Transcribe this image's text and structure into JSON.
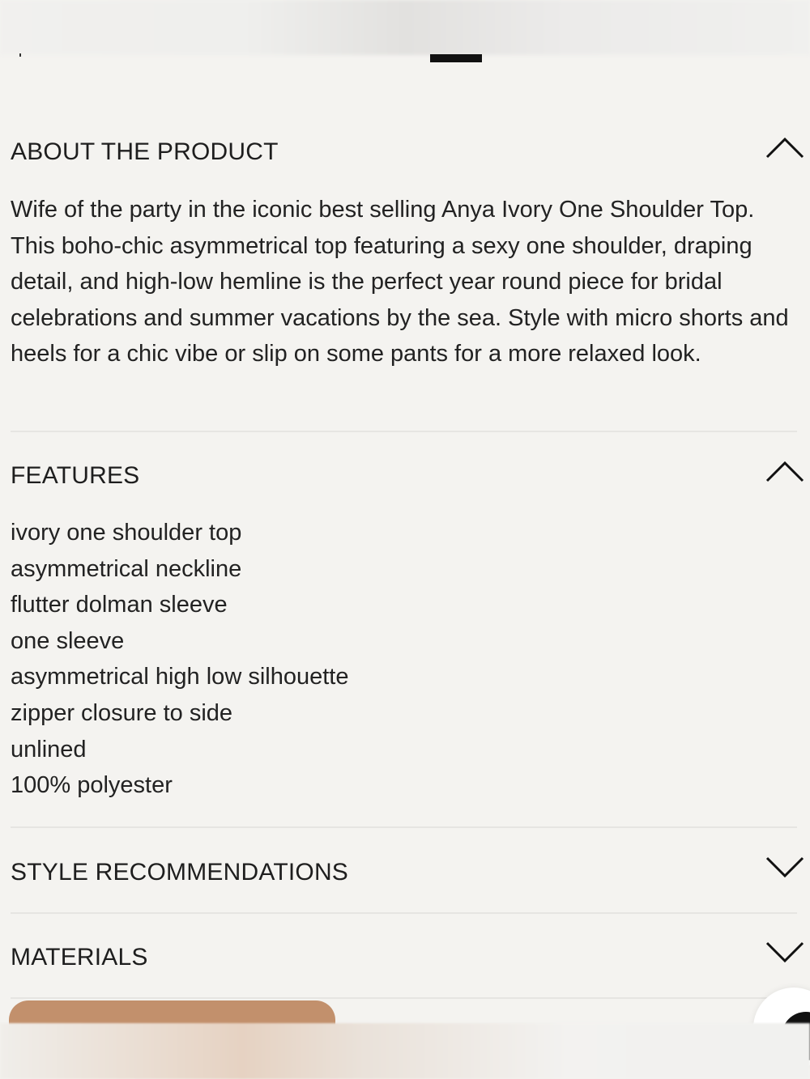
{
  "sections": {
    "about": {
      "title": "ABOUT THE PRODUCT",
      "expanded": true,
      "description": "Wife of the party in the iconic best selling Anya Ivory One Shoulder Top. This boho-chic asymmetrical top featuring a sexy one shoulder, draping detail, and high-low hemline is the perfect year round piece for bridal celebrations and summer vacations by the sea. Style with micro shorts and heels for a chic vibe or slip on some pants for a more relaxed look."
    },
    "features": {
      "title": "FEATURES",
      "expanded": true,
      "items": [
        "ivory one shoulder top",
        "asymmetrical neckline",
        "flutter dolman sleeve",
        "one sleeve",
        "asymmetrical high low silhouette",
        "zipper closure to side",
        "unlined",
        "100% polyester"
      ]
    },
    "style": {
      "title": "STYLE RECOMMENDATIONS",
      "expanded": false
    },
    "materials": {
      "title": "MATERIALS",
      "expanded": false
    }
  },
  "icons": {
    "expanded": "chevron-up-icon",
    "collapsed": "chevron-down-icon",
    "chat": "chat-icon"
  },
  "colors": {
    "background": "#f4f3f0",
    "text": "#1e1e1e",
    "cta": "#c2906c",
    "divider": "#e6e5e2"
  }
}
